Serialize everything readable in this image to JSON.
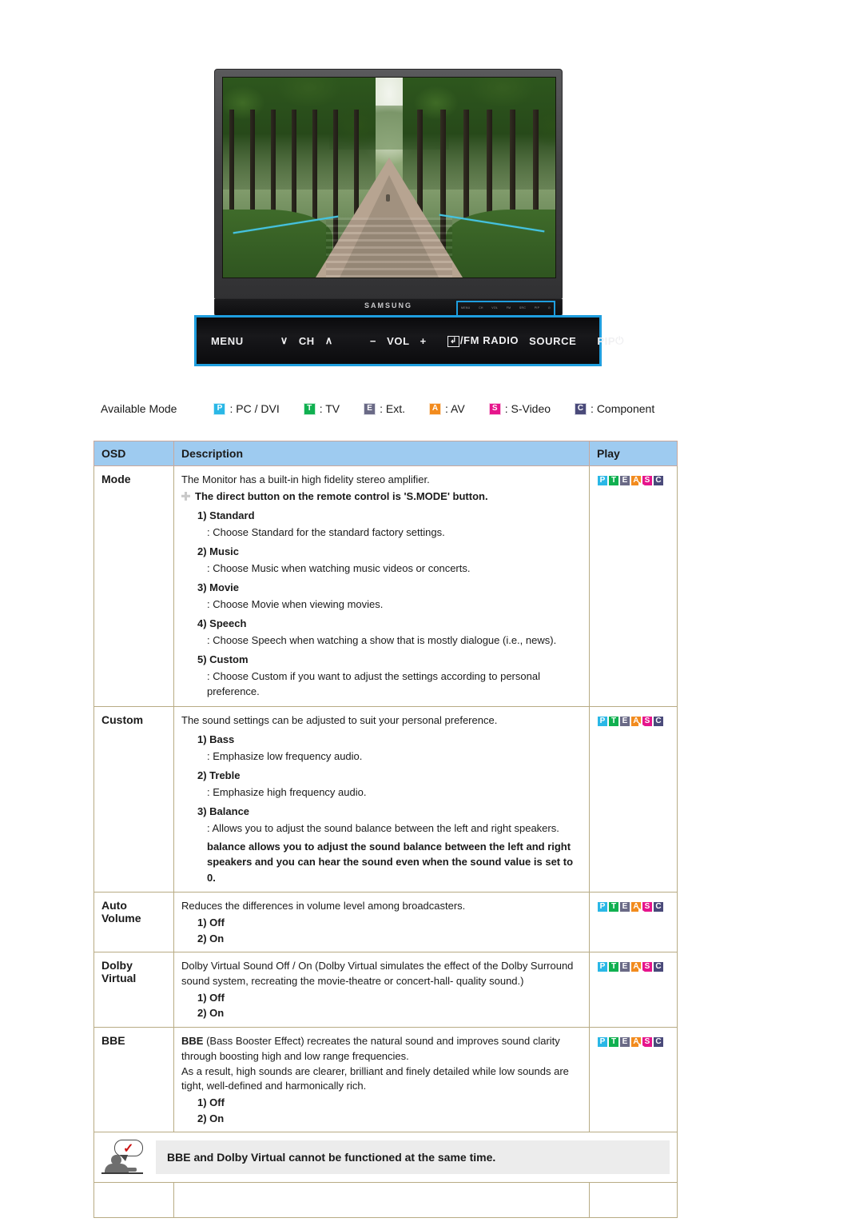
{
  "device": {
    "brand_logo": "SAMSUNG",
    "screen_scene": "tree-lined-garden-path",
    "control_bar": {
      "menu_label": "MENU",
      "ch_down_glyph": "∨",
      "ch_label": "CH",
      "ch_up_glyph": "∧",
      "vol_down_glyph": "−",
      "vol_label": "VOL",
      "vol_up_glyph": "+",
      "enter_glyph": "↲",
      "fm_radio_label": "/FM RADIO",
      "source_label": "SOURCE",
      "pip_label": "PIP",
      "power_glyph": "⏻"
    },
    "highlight_color": "#1f9ede"
  },
  "legend": {
    "title": "Available Mode",
    "items": [
      {
        "code": "P",
        "label": ": PC / DVI",
        "color": "#2ab7e6"
      },
      {
        "code": "T",
        "label": ": TV",
        "color": "#10b050"
      },
      {
        "code": "E",
        "label": ": Ext.",
        "color": "#6a6a86"
      },
      {
        "code": "A",
        "label": ": AV",
        "color": "#f28b1e"
      },
      {
        "code": "S",
        "label": ": S-Video",
        "color": "#e6158c"
      },
      {
        "code": "C",
        "label": ": Component",
        "color": "#4a4a7a"
      }
    ]
  },
  "table": {
    "headers": {
      "osd": "OSD",
      "description": "Description",
      "play": "Play"
    },
    "header_bg": "#9ecbf0",
    "border_color": "#b8ab84",
    "play_chips": [
      {
        "code": "P",
        "color": "#2ab7e6"
      },
      {
        "code": "T",
        "color": "#10b050"
      },
      {
        "code": "E",
        "color": "#6a6a86"
      },
      {
        "code": "A",
        "color": "#f28b1e"
      },
      {
        "code": "S",
        "color": "#e6158c"
      },
      {
        "code": "C",
        "color": "#4a4a7a"
      }
    ],
    "rows": {
      "mode": {
        "osd": "Mode",
        "lead": "The Monitor has a built-in high fidelity stereo amplifier.",
        "note": "The direct button on the remote control is 'S.MODE' button.",
        "options": [
          {
            "num": "1) Standard",
            "desc": ": Choose Standard for the standard factory settings."
          },
          {
            "num": "2) Music",
            "desc": ": Choose Music when watching music videos or concerts."
          },
          {
            "num": "3) Movie",
            "desc": ": Choose Movie when viewing movies."
          },
          {
            "num": "4) Speech",
            "desc": ": Choose Speech when watching a show that is mostly dialogue (i.e., news)."
          },
          {
            "num": "5) Custom",
            "desc": ": Choose Custom if you want to adjust the settings according to personal preference."
          }
        ]
      },
      "custom": {
        "osd": "Custom",
        "lead": "The sound settings can be adjusted to suit your personal preference.",
        "options": [
          {
            "num": "1) Bass",
            "desc": ": Emphasize low frequency audio."
          },
          {
            "num": "2) Treble",
            "desc": ": Emphasize high frequency audio."
          },
          {
            "num": "3) Balance",
            "desc": ": Allows you to adjust the sound balance between the left and right speakers."
          }
        ],
        "bold_note": "balance allows you to adjust the sound balance between the left and right speakers and you can hear the sound even when the sound value is set to 0."
      },
      "auto_volume": {
        "osd_line1": "Auto",
        "osd_line2": "Volume",
        "lead": "Reduces the differences in volume level among broadcasters.",
        "options": [
          "1) Off",
          "2) On"
        ]
      },
      "dolby_virtual": {
        "osd_line1": "Dolby",
        "osd_line2": "Virtual",
        "lead": "Dolby Virtual Sound Off / On (Dolby Virtual simulates the effect of the Dolby Surround sound system, recreating the movie-theatre or concert-hall- quality sound.)",
        "options": [
          "1) Off",
          "2) On"
        ]
      },
      "bbe": {
        "osd": "BBE",
        "lead_bold": "BBE",
        "lead_rest": " (Bass Booster Effect) recreates the natural sound and improves sound clarity through boosting high and low range frequencies.",
        "lead2": "As a result, high sounds are clearer, brilliant and finely detailed while low sounds are tight, well-defined and harmonically rich.",
        "options": [
          "1) Off",
          "2) On"
        ]
      }
    },
    "footer_note": {
      "icon": "person-speech-bubble-check-icon",
      "text": "BBE and Dolby Virtual cannot be functioned at the same time."
    }
  }
}
